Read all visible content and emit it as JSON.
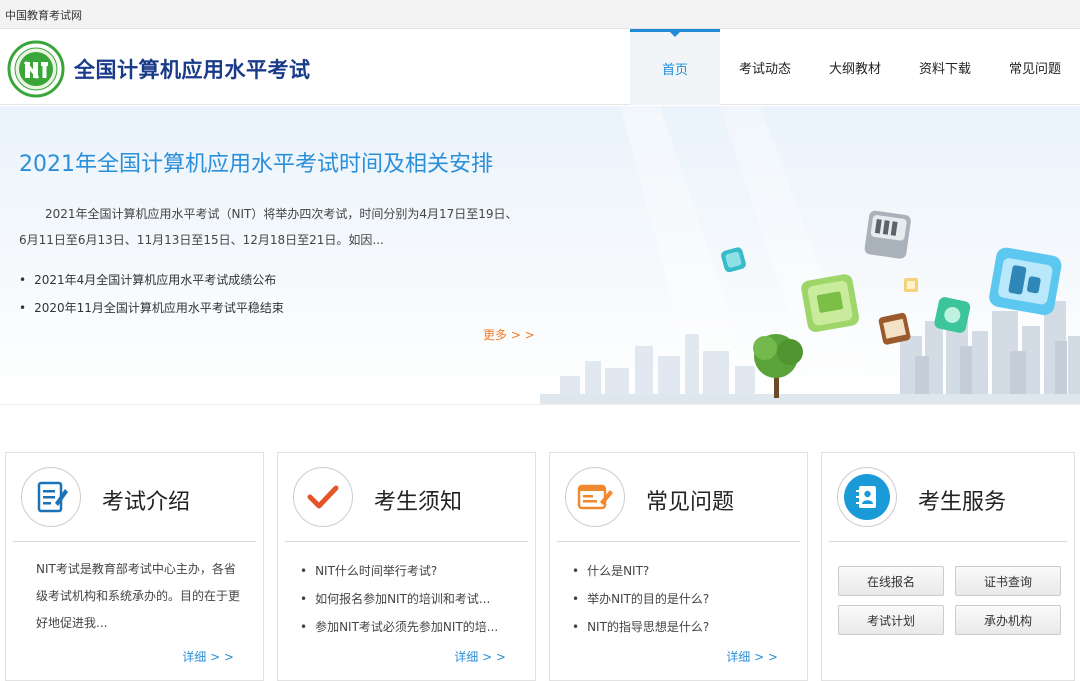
{
  "topbar": {
    "text": "中国教育考试网"
  },
  "header": {
    "site_title": "全国计算机应用水平考试",
    "nav": [
      {
        "label": "首页",
        "active": true
      },
      {
        "label": "考试动态"
      },
      {
        "label": "大纲教材"
      },
      {
        "label": "资料下载"
      },
      {
        "label": "常见问题"
      }
    ]
  },
  "banner": {
    "title": "2021年全国计算机应用水平考试时间及相关安排",
    "desc": "2021年全国计算机应用水平考试（NIT）将举办四次考试，时间分别为4月17日至19日、6月11日至6月13日、11月13日至15日、12月18日至21日。如因...",
    "links": [
      "2021年4月全国计算机应用水平考试成绩公布",
      "2020年11月全国计算机应用水平考试平稳结束"
    ],
    "more": "更多 > >"
  },
  "cards": {
    "intro": {
      "title": "考试介绍",
      "text": "NIT考试是教育部考试中心主办，各省级考试机构和系统承办的。目的在于更好地促进我...",
      "more": "详细 > >"
    },
    "notice": {
      "title": "考生须知",
      "items": [
        "NIT什么时间举行考试?",
        "如何报名参加NIT的培训和考试...",
        "参加NIT考试必须先参加NIT的培..."
      ],
      "more": "详细 > >"
    },
    "faq": {
      "title": "常见问题",
      "items": [
        "什么是NIT?",
        "举办NIT的目的是什么?",
        "NIT的指导思想是什么?"
      ],
      "more": "详细 > >"
    },
    "service": {
      "title": "考生服务",
      "buttons": [
        "在线报名",
        "证书查询",
        "考试计划",
        "承办机构"
      ]
    }
  },
  "colors": {
    "accent": "#1f8bd6",
    "more_orange": "#f07a28",
    "title_navy": "#1a3a8a"
  },
  "icons": {
    "logo": "nit-logo",
    "intro": "document-edit-icon",
    "notice": "checkmark-icon",
    "faq": "question-list-icon",
    "service": "contact-book-icon"
  }
}
